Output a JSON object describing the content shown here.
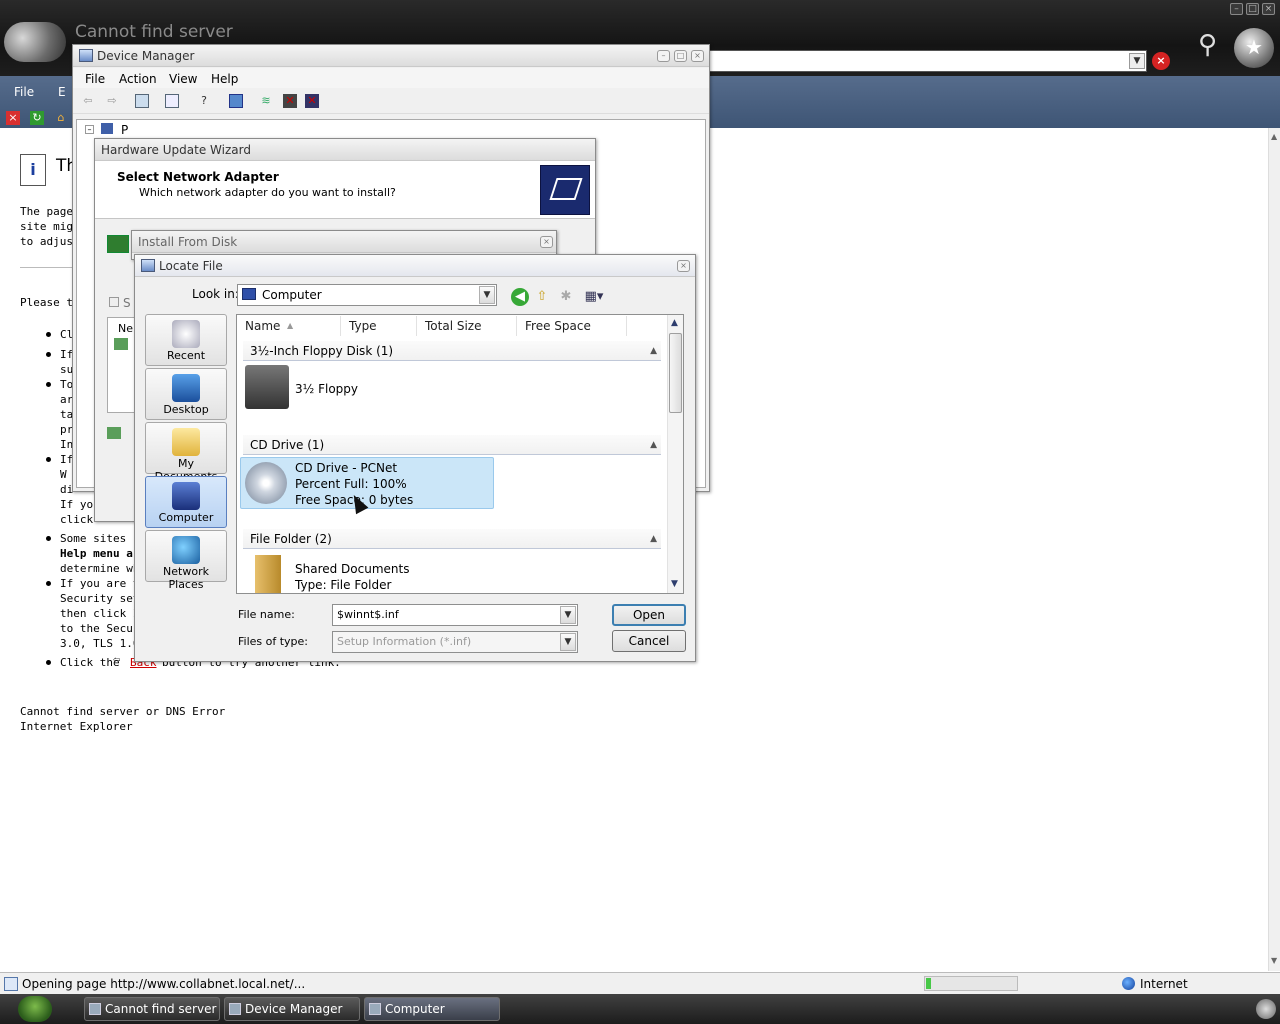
{
  "ie": {
    "title": "Cannot find server",
    "menu": {
      "file": "File",
      "edit": "E"
    },
    "page_heading": "Th",
    "intro_lines": [
      "The page",
      "site migh",
      "to adjust"
    ],
    "please_try": "Please tr",
    "bullets": [
      [
        "Cl"
      ],
      [
        "If",
        "su"
      ],
      [
        "To",
        "ar",
        "ta",
        "pr",
        "In"
      ],
      [
        "If",
        "W",
        "di",
        "If you",
        "click"
      ],
      [
        "Some sites r",
        "Help menu a",
        "determine wh"
      ],
      [
        "If you are try",
        "Security setti",
        "then click In",
        "to the Securi",
        "3.0, TLS 1.0,"
      ],
      [
        "Click the",
        "Back",
        "button to try another link."
      ]
    ],
    "footer_lines": [
      "Cannot find server or DNS Error",
      "Internet Explorer"
    ],
    "status_text": "Opening page http://www.collabnet.local.net/...",
    "zone": "Internet",
    "progress": 0.05
  },
  "device_manager": {
    "title": "Device Manager",
    "menu": [
      "File",
      "Action",
      "View",
      "Help"
    ],
    "tree_root": "P"
  },
  "hardware_wizard": {
    "title": "Hardware Update Wizard",
    "heading": "Select Network Adapter",
    "subheading": "Which network adapter do you want to install?",
    "fragments": {
      "s": "S",
      "ne": "Ne"
    }
  },
  "install_from_disk": {
    "title": "Install From Disk"
  },
  "locate_file": {
    "title": "Locate File",
    "look_in_label": "Look in:",
    "look_in_value": "Computer",
    "places": [
      "Recent",
      "Desktop",
      "My Documents",
      "Computer",
      "Network Places"
    ],
    "active_place": "Computer",
    "columns": [
      "Name",
      "Type",
      "Total Size",
      "Free Space"
    ],
    "groups": [
      {
        "header": "3½-Inch Floppy Disk (1)",
        "items": [
          {
            "name": "3½ Floppy"
          }
        ]
      },
      {
        "header": "CD Drive (1)",
        "items": [
          {
            "name": "CD Drive - PCNet",
            "line2": "Percent Full: 100%",
            "line3": "Free Space: 0 bytes"
          }
        ]
      },
      {
        "header": "File Folder (2)",
        "items": [
          {
            "name": "Shared Documents",
            "line2": "Type: File Folder"
          }
        ]
      }
    ],
    "file_name_label": "File name:",
    "file_name_value": "$winnt$.inf",
    "file_type_label": "Files of type:",
    "file_type_value": "Setup Information (*.inf)",
    "open_button": "Open",
    "cancel_button": "Cancel"
  },
  "taskbar": {
    "buttons": [
      "Cannot find server",
      "Device Manager",
      "Computer"
    ]
  },
  "colors": {
    "ie_frame": "#1e1e1e",
    "ie_toolbar": "#4c6282",
    "selection": "#cbe6f8",
    "default_button_border": "#3c7fb1"
  }
}
